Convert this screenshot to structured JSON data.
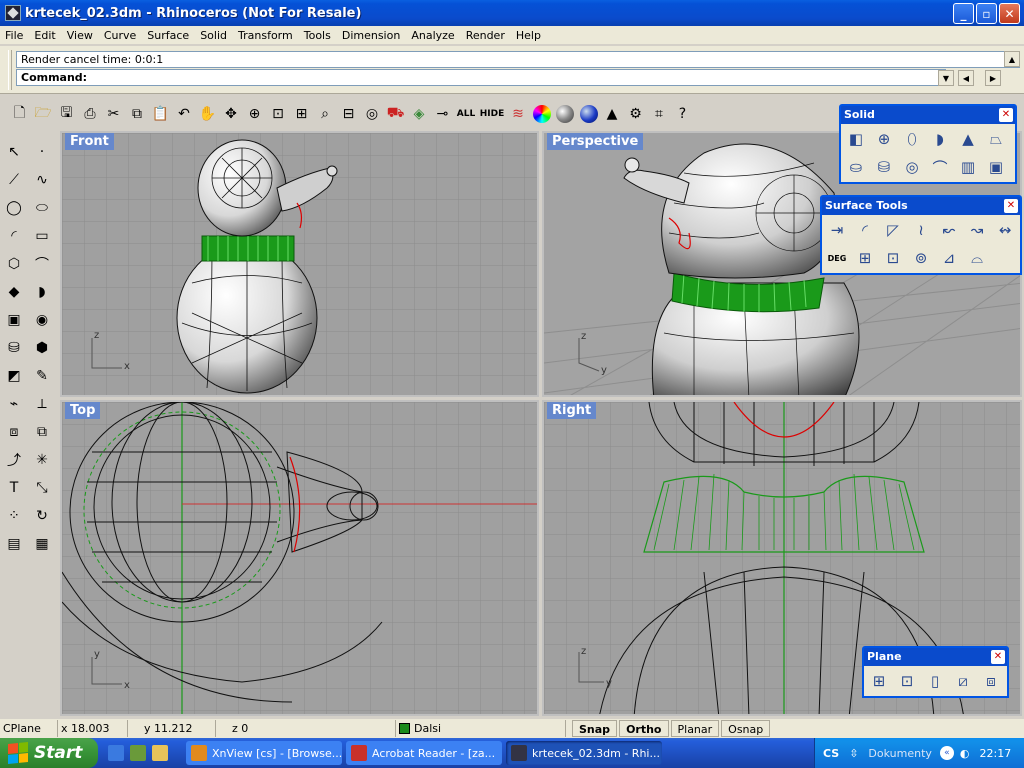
{
  "window": {
    "title": "krtecek_02.3dm - Rhinoceros (Not For Resale)",
    "minimize": "_",
    "maximize": "▫",
    "close": "✕"
  },
  "menu": [
    "File",
    "Edit",
    "View",
    "Curve",
    "Surface",
    "Solid",
    "Transform",
    "Tools",
    "Dimension",
    "Analyze",
    "Render",
    "Help"
  ],
  "command": {
    "history": "Render cancel time: 0:0:1",
    "prompt": "Command:"
  },
  "toolbar": {
    "icons": [
      "new-file-icon",
      "open-file-icon",
      "save-icon",
      "print-icon",
      "cut-icon",
      "copy-icon",
      "paste-icon",
      "undo-icon",
      "pan-icon",
      "rotate-view-icon",
      "zoom-dynamic-icon",
      "zoom-window-icon",
      "zoom-extents-icon",
      "zoom-selected-icon",
      "zoom-all-icon",
      "car-icon",
      "layer-icon",
      "point-on-icon"
    ],
    "all_label": "ALL",
    "hide_label": "HIDE"
  },
  "viewports": {
    "front": "Front",
    "perspective": "Perspective",
    "top": "Top",
    "right": "Right"
  },
  "palettes": {
    "solid": {
      "title": "Solid",
      "icons": [
        "box-icon",
        "sphere-icon",
        "ellipsoid-icon",
        "paraboloid-icon",
        "cone-icon",
        "truncated-cone-icon",
        "cylinder-icon",
        "tube-icon",
        "torus-icon",
        "pipe-icon",
        "extrude-icon",
        "cap-icon"
      ]
    },
    "surface_tools": {
      "title": "Surface Tools",
      "icons": [
        "extend-surface-icon",
        "fillet-surface-icon",
        "chamfer-surface-icon",
        "offset-surface-icon",
        "blend-surface-icon",
        "match-surface-icon",
        "merge-surface-icon",
        "change-degree-icon",
        "rebuild-surface-icon",
        "shrink-surface-icon",
        "split-edge-icon",
        "symmetry-icon",
        "surface-from-network-icon"
      ],
      "deg_label": "DEG"
    },
    "plane": {
      "title": "Plane",
      "icons": [
        "plane-corner-icon",
        "plane-center-icon",
        "vertical-plane-icon",
        "plane-3point-icon",
        "cutting-plane-icon"
      ]
    }
  },
  "status": {
    "cplane": "CPlane",
    "x": "x 18.003",
    "y": "y 11.212",
    "z": "z 0",
    "layer": "Dalsi",
    "layer_color": "#1a8a1a",
    "snap": "Snap",
    "ortho": "Ortho",
    "planar": "Planar",
    "osnap": "Osnap"
  },
  "taskbar": {
    "start": "Start",
    "tasks": [
      {
        "label": "XnView [cs] - [Browse...",
        "color": "#e08a1e"
      },
      {
        "label": "Acrobat Reader - [za...",
        "color": "#c8312a"
      },
      {
        "label": "krtecek_02.3dm - Rhi...",
        "color": "#333344"
      }
    ],
    "lang": "CS",
    "docs": "Dokumenty",
    "clock": "22:17"
  },
  "colors": {
    "viewport_bg": "#a0a0a0",
    "grid": "#8c8c8c",
    "green_band": "#1a9a1a",
    "active_label": "#6688cc"
  }
}
